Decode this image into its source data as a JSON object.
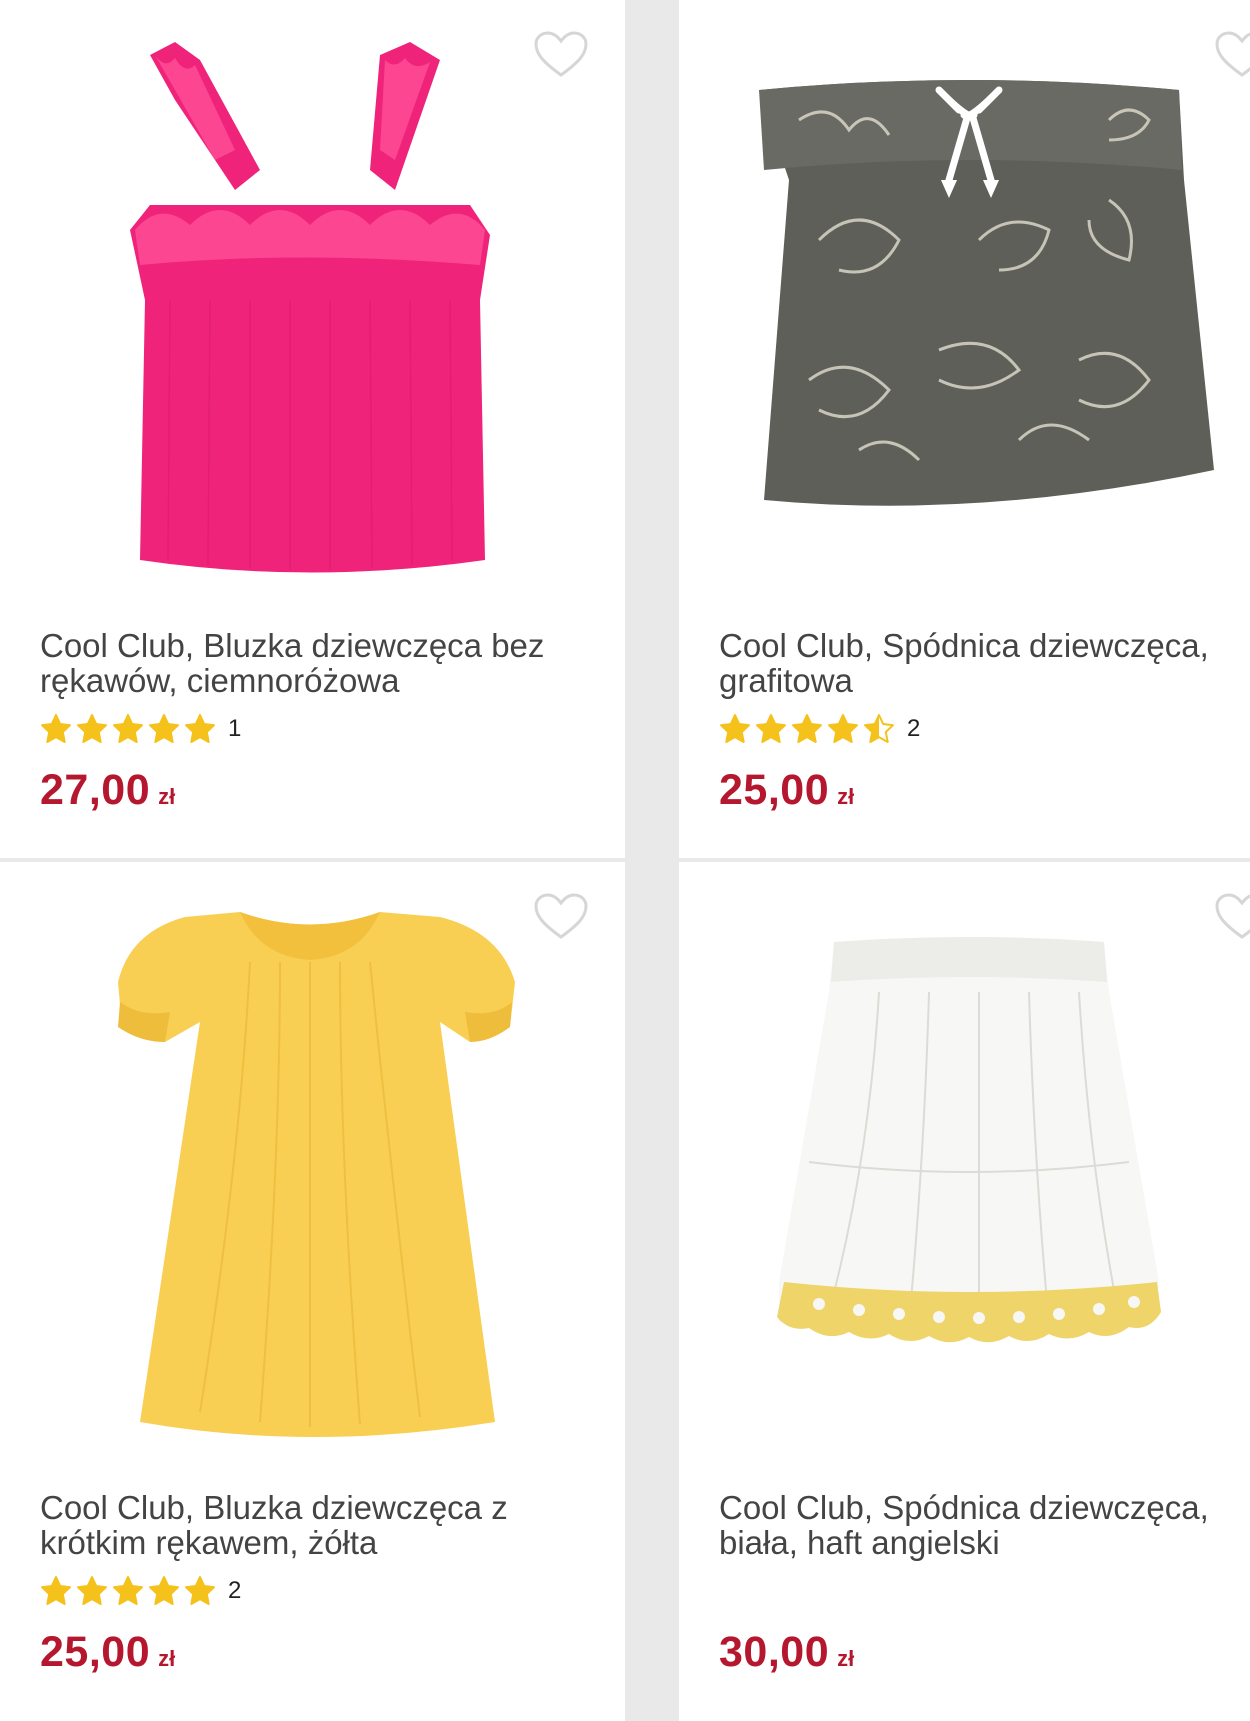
{
  "colors": {
    "price": "#b5172e",
    "star": "#f4c21a",
    "heart": "#d6d6d6",
    "background": "#e9e9e9"
  },
  "products": [
    {
      "title": "Cool Club, Bluzka dziewczęca bez rękawów, ciemnoróżowa",
      "rating": 5,
      "rating_count": "1",
      "price": "27,00",
      "currency": "zł",
      "image_icon": "pink-top-image"
    },
    {
      "title": "Cool Club, Spódnica dziewczęca, grafitowa",
      "rating": 4.5,
      "rating_count": "2",
      "price": "25,00",
      "currency": "zł",
      "image_icon": "grey-skirt-image"
    },
    {
      "title": "Cool Club, Bluzka dziewczęca z krótkim rękawem, żółta",
      "rating": 5,
      "rating_count": "2",
      "price": "25,00",
      "currency": "zł",
      "image_icon": "yellow-blouse-image"
    },
    {
      "title": "Cool Club, Spódnica dziewczęca, biała, haft angielski",
      "rating": null,
      "rating_count": "",
      "price": "30,00",
      "currency": "zł",
      "image_icon": "white-skirt-image"
    }
  ]
}
